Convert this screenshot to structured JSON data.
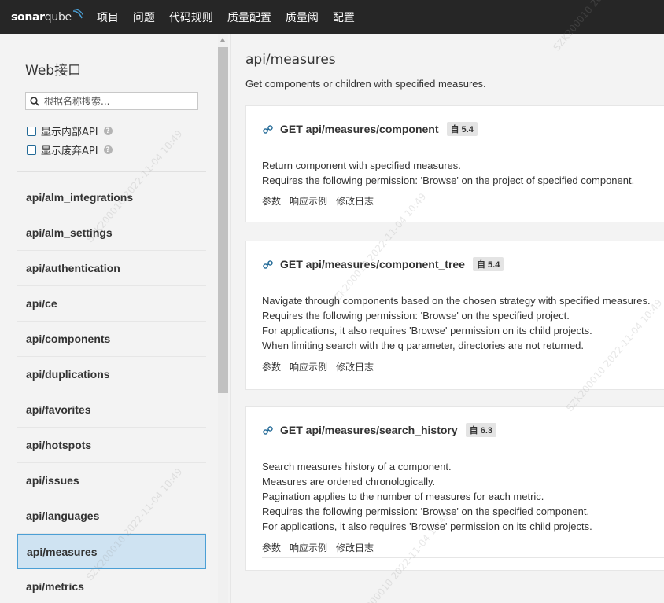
{
  "brand": {
    "name_bold": "sonar",
    "name_light": "qube"
  },
  "nav": [
    "项目",
    "问题",
    "代码规则",
    "质量配置",
    "质量阈",
    "配置"
  ],
  "sidebar": {
    "title": "Web接口",
    "search_placeholder": "根据名称搜索...",
    "show_internal": "显示内部API",
    "show_deprecated": "显示废弃API",
    "help": "?",
    "items": [
      "api/alm_integrations",
      "api/alm_settings",
      "api/authentication",
      "api/ce",
      "api/components",
      "api/duplications",
      "api/favorites",
      "api/hotspots",
      "api/issues",
      "api/languages",
      "api/measures",
      "api/metrics"
    ],
    "selected": "api/measures"
  },
  "main": {
    "title": "api/measures",
    "description": "Get components or children with specified measures.",
    "tabs": [
      "参数",
      "响应示例",
      "修改日志"
    ],
    "endpoints": [
      {
        "method": "GET api/measures/component",
        "since": "自 5.4",
        "lines": [
          "Return component with specified measures.",
          "Requires the following permission: 'Browse' on the project of specified component."
        ]
      },
      {
        "method": "GET api/measures/component_tree",
        "since": "自 5.4",
        "lines": [
          "Navigate through components based on the chosen strategy with specified measures.",
          "Requires the following permission: 'Browse' on the specified project.",
          "For applications, it also requires 'Browse' permission on its child projects.",
          "When limiting search with the q parameter, directories are not returned."
        ]
      },
      {
        "method": "GET api/measures/search_history",
        "since": "自 6.3",
        "lines": [
          "Search measures history of a component.",
          "Measures are ordered chronologically.",
          "Pagination applies to the number of measures for each metric.",
          "Requires the following permission: 'Browse' on the specified component.",
          "For applications, it also requires 'Browse' permission on its child projects."
        ]
      }
    ]
  },
  "watermark": {
    "a": "SZK200010 2022-11-04 10:49",
    "b": "SZK200010 20"
  },
  "colors": {
    "topbar": "#262626",
    "selected_bg": "#cfe3f2",
    "selected_border": "#4b9fd5",
    "link_icon": "#236a97"
  }
}
